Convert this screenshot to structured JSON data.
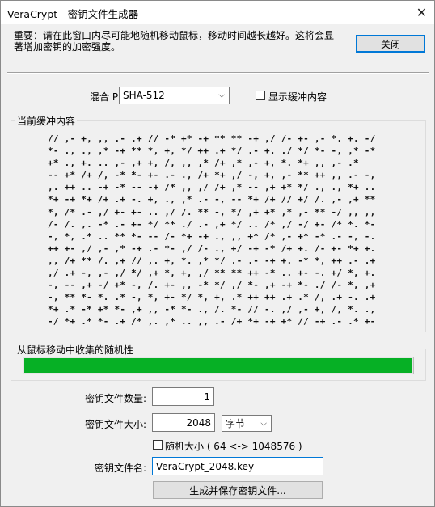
{
  "window": {
    "title": "VeraCrypt - 密钥文件生成器"
  },
  "header": {
    "notice_line1": "重要：请在此窗口内尽可能地随机移动鼠标，移动时间越长越好。这将会显",
    "notice_line2": "著增加密钥的加密强度。",
    "close_button": "关闭"
  },
  "prf": {
    "label": "混合 PRF:",
    "selected": "SHA-512",
    "show_pool_label": "显示缓冲内容",
    "show_pool_checked": false
  },
  "pool": {
    "label": "当前缓冲内容",
    "lines": [
      "// ,- +, ,, .- .+ // -* +* -+ ** ** -+ ,/ /- +- ,- *. +. -/",
      "*- ., ., ,* -+ ** *, +, */ ++ .+ */ .- +. ./ */ *- -, ,* -*",
      "+* ., +. .. ,- ,+ +, /, ,, ,* /+ ,* ,- +, *. *+ ,, ,- .*",
      "-- +* /+ /, -* *- +- .- ., /+ *+ ,/ -, +, ,- ** ++ ,, .- -,",
      ",. ++ .. -+ -* -- -+ /* ,, ,/ /+ ,* -- ,+ +* */ ., ., *+ ..",
      "*+ -+ *+ /+ .+ -. +, ., ,* .- -, -- *+ /+ // +/ /. ,- ,+ **",
      "*, /* .- ,/ +- +- .. ,/ /. ** -, */ ,+ +* ,* ,- ** -/ ,, ,,",
      "/- /. ,. -* .- +- */ ** ./ .- ,+ */ .. /* ,/ -/ +- /* *. *-",
      "-, *, .* .. ** *- -- /- *+ -+ ., ,, +* /* ,- +* -* .- -, -.",
      "++ +- ,/ ,- ,* -+ .- *- ,/ /- ., +/ -+ -* /+ +. /- +- *+ +.",
      ",, /+ ** /. ,+ // ,. +, *. ,* */ .- .- -+ +. -* *, ++ .- .+",
      ",/ .+ -, ,- ,/ */ ,+ *, +, ,/ ** ** ++ -* .. +- -. +/ *, +.",
      "-, -- ,+ -/ +* -, /. +- ,, -* */ ,/ *- ,+ -+ *- ./ /- *, ,+",
      "-, ** *- *. .* -, *, +- */ *, +, .* ++ ++ .+ .* /, .+ -. .+",
      "*+ .* -* +* *- ,+ ,, -* *- ., /. *- // -. ,/ ,- +, /, *. .,",
      "-/ *+ .* *- .+ /* ,. ,* .. ,, .- /+ *+ -+ +* // -+ .- .* +-"
    ]
  },
  "progress": {
    "label": "从鼠标移动中收集的随机性",
    "value": 1.0,
    "color": "#06b025"
  },
  "form": {
    "count_label": "密钥文件数量:",
    "count_value": "1",
    "size_label": "密钥文件大小:",
    "size_value": "2048",
    "size_unit": "字节",
    "random_size_label": "随机大小 ( 64 <-> 1048576 )",
    "random_size_checked": false,
    "name_label": "密钥文件名:",
    "name_value": "VeraCrypt_2048.key",
    "generate_button": "生成并保存密钥文件..."
  },
  "icons": {
    "close": "close-icon",
    "dropdown": "chevron-down-icon"
  }
}
